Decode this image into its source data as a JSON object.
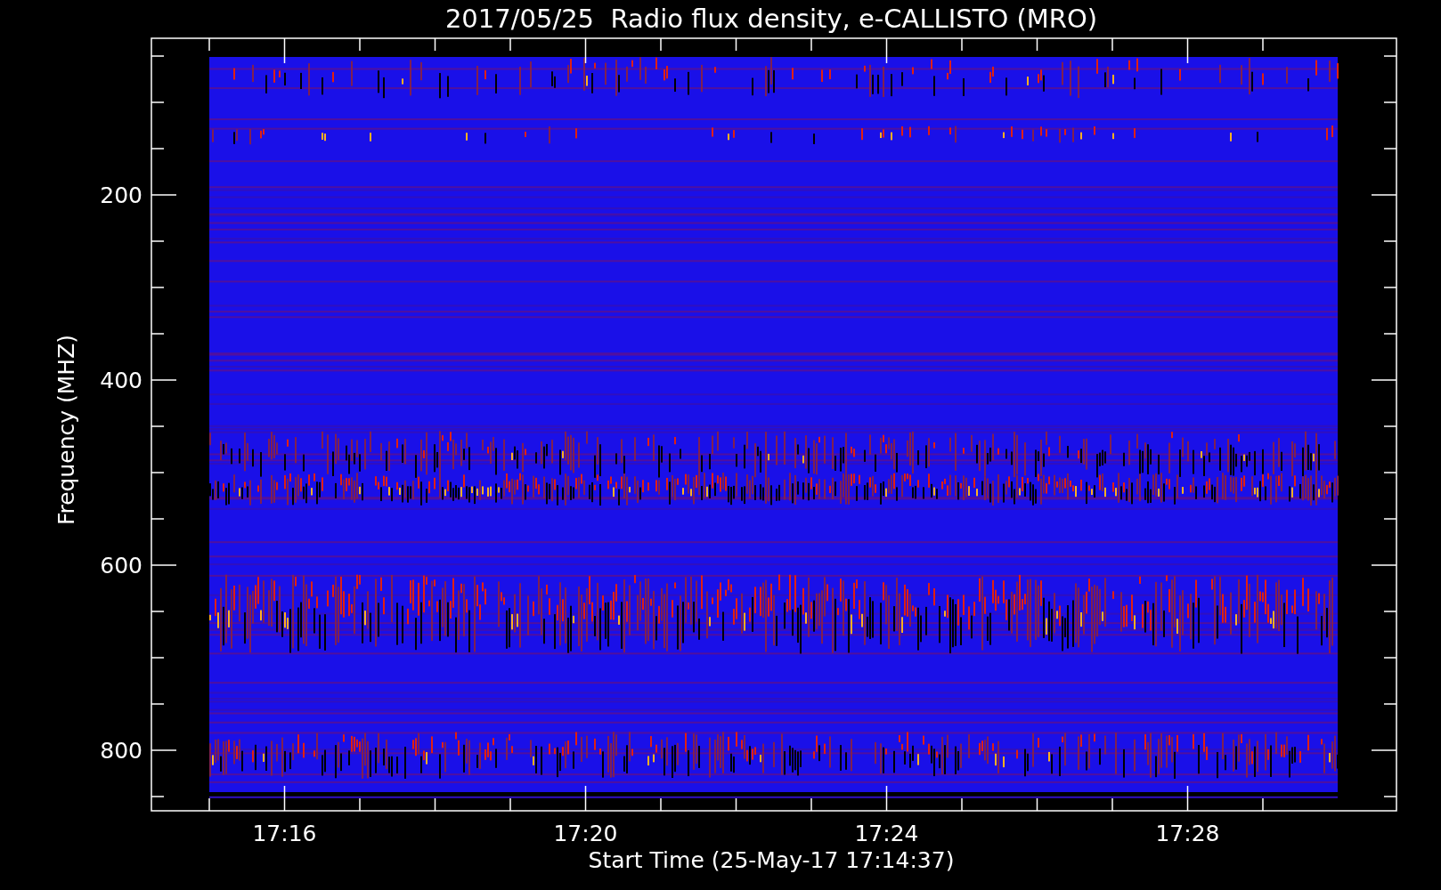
{
  "plot": {
    "title": "2017/05/25  Radio flux density, e-CALLISTO (MRO)",
    "ylabel": "Frequency (MHZ)",
    "xlabel": "Start Time (25-May-17 17:14:37)",
    "yticks": [
      "200",
      "400",
      "600",
      "800"
    ],
    "xticks": [
      "17:16",
      "17:20",
      "17:24",
      "17:28"
    ]
  }
}
